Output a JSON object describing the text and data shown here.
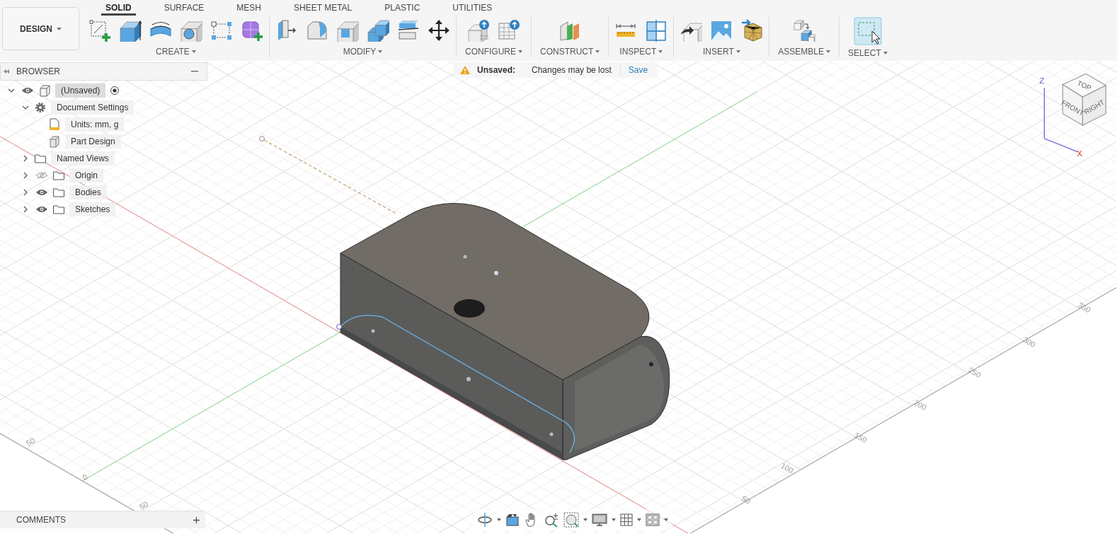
{
  "workspace_button": {
    "label": "DESIGN"
  },
  "tabs": [
    {
      "label": "SOLID",
      "selected": true
    },
    {
      "label": "SURFACE",
      "selected": false
    },
    {
      "label": "MESH",
      "selected": false
    },
    {
      "label": "SHEET METAL",
      "selected": false
    },
    {
      "label": "PLASTIC",
      "selected": false
    },
    {
      "label": "UTILITIES",
      "selected": false
    }
  ],
  "tool_groups": [
    {
      "label": "CREATE"
    },
    {
      "label": "MODIFY"
    },
    {
      "label": "CONFIGURE"
    },
    {
      "label": "CONSTRUCT"
    },
    {
      "label": "INSPECT"
    },
    {
      "label": "INSERT"
    },
    {
      "label": "ASSEMBLE"
    },
    {
      "label": "SELECT"
    }
  ],
  "browser": {
    "title": "BROWSER",
    "tree": [
      {
        "label": "(Unsaved)",
        "kind": "component",
        "expanded": true,
        "visible": true,
        "active": true,
        "selected": true,
        "children": [
          {
            "label": "Document Settings",
            "kind": "settings",
            "expanded": true,
            "selected": false,
            "children": [
              {
                "label": "Units: mm, g",
                "kind": "units",
                "selected": false
              },
              {
                "label": "Part Design",
                "kind": "design",
                "selected": false
              }
            ]
          },
          {
            "label": "Named Views",
            "kind": "folder",
            "expanded": false,
            "selected": false
          },
          {
            "label": "Origin",
            "kind": "folder",
            "expanded": false,
            "visible": false,
            "selected": false
          },
          {
            "label": "Bodies",
            "kind": "folder",
            "expanded": false,
            "visible": true,
            "selected": false
          },
          {
            "label": "Sketches",
            "kind": "folder",
            "expanded": false,
            "visible": true,
            "selected": false
          }
        ]
      }
    ]
  },
  "notice": {
    "label": "Unsaved:",
    "message": "Changes may be lost",
    "action": "Save"
  },
  "view_cube": {
    "top": "TOP",
    "front": "FRONT",
    "right": "RIGHT",
    "z_axis": "Z",
    "x_axis": "X"
  },
  "grid_labels": {
    "left_edge": [
      "50",
      "0",
      "50"
    ],
    "right_edge": [
      "50",
      "100",
      "150",
      "200",
      "250",
      "300",
      "350"
    ]
  },
  "comments": {
    "title": "COMMENTS"
  }
}
